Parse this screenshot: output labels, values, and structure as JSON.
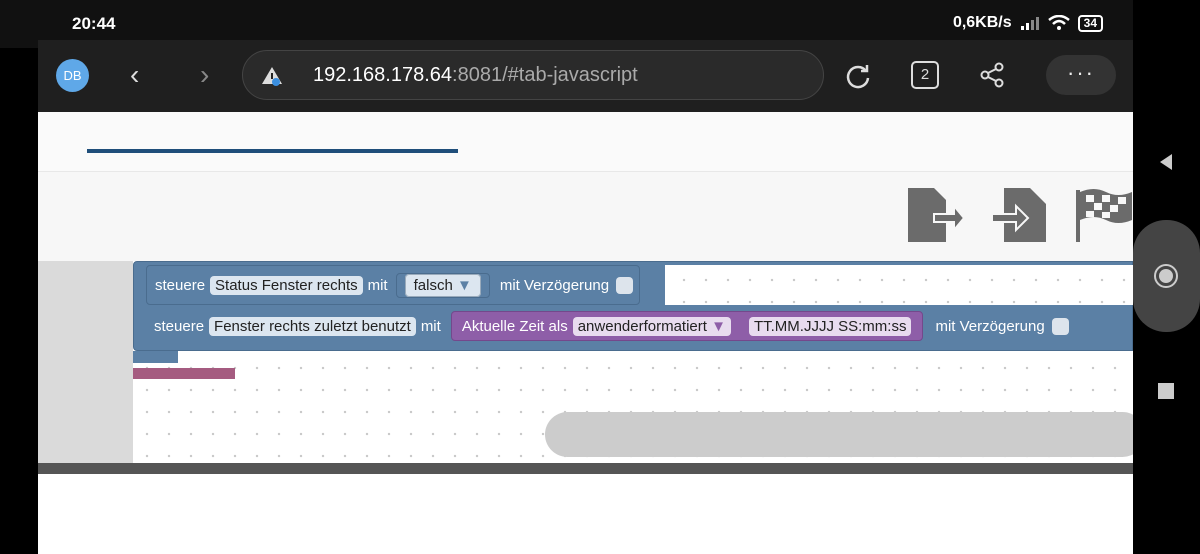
{
  "status": {
    "time": "20:44",
    "speed": "0,6KB/s",
    "battery": "34"
  },
  "browser": {
    "avatar": "DB",
    "url_host": "192.168.178.64",
    "url_rest": ":8081/#tab-javascript",
    "tab_count": "2",
    "menu": "···"
  },
  "blocks": {
    "b1": {
      "steuere": "steuere",
      "target": "Status Fenster rechts",
      "mit": "mit",
      "value": "falsch",
      "delay": "mit Verzögerung"
    },
    "b2": {
      "steuere": "steuere",
      "target": "Fenster rechts zuletzt benutzt",
      "mit": "mit",
      "func": "Aktuelle Zeit als",
      "format": "anwenderformatiert",
      "pattern": "TT.MM.JJJJ SS:mm:ss",
      "delay": "mit Verzögerung"
    }
  },
  "icons": [
    "export-icon",
    "import-icon",
    "flag-icon",
    "back-icon",
    "forward-icon",
    "reload-icon",
    "share-icon",
    "home-icon",
    "recents-icon"
  ],
  "colors": {
    "block": "#5b80a5",
    "purple": "#8e5ea8",
    "accent": "#1f4e7a"
  }
}
